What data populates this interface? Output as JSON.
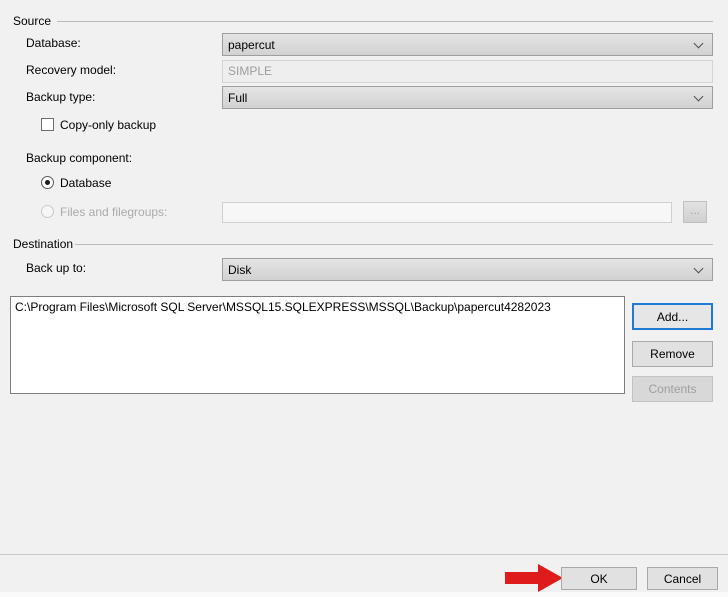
{
  "source": {
    "group_label": "Source",
    "database_label": "Database:",
    "database_value": "papercut",
    "recovery_model_label": "Recovery model:",
    "recovery_model_value": "SIMPLE",
    "backup_type_label": "Backup type:",
    "backup_type_value": "Full",
    "copy_only_label": "Copy-only backup",
    "copy_only_checked": false,
    "backup_component_label": "Backup component:",
    "radio_database_label": "Database",
    "radio_files_label": "Files and filegroups:",
    "files_field_value": "",
    "browse_button_label": "..."
  },
  "destination": {
    "group_label": "Destination",
    "back_up_to_label": "Back up to:",
    "back_up_to_value": "Disk",
    "backup_paths": [
      "C:\\Program Files\\Microsoft SQL Server\\MSSQL15.SQLEXPRESS\\MSSQL\\Backup\\papercut4282023"
    ],
    "add_button_label": "Add...",
    "remove_button_label": "Remove",
    "contents_button_label": "Contents"
  },
  "footer": {
    "ok_label": "OK",
    "cancel_label": "Cancel"
  },
  "colors": {
    "accent_blue": "#1e7ad4",
    "arrow_red": "#e01b1b"
  }
}
